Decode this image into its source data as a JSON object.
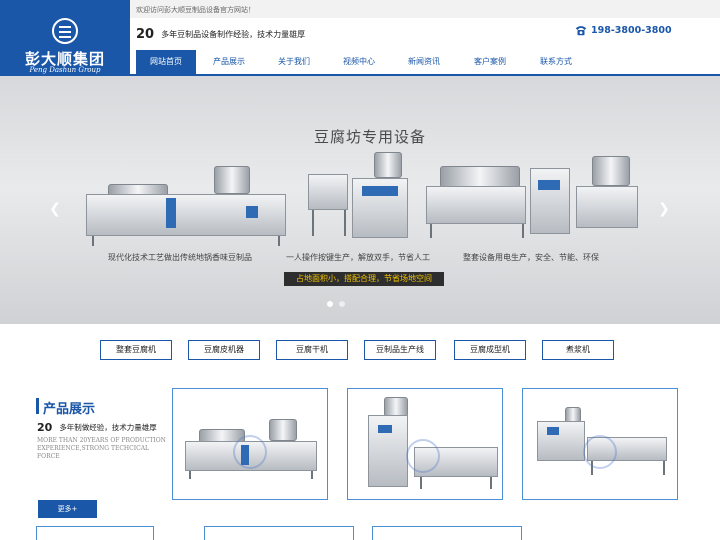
{
  "brand": {
    "name_cn": "彭大顺集团",
    "name_en": "Peng Dashun Group"
  },
  "topbar": {
    "welcome": "欢迎访问彭大顺豆制品设备官方网站！"
  },
  "slogan": {
    "number": "20",
    "text": "多年豆制品设备制作经验，技术力量雄厚"
  },
  "contact": {
    "phone": "198-3800-3800",
    "icon": "telephone-icon"
  },
  "nav": {
    "items": [
      {
        "label": "网站首页",
        "active": true
      },
      {
        "label": "产品展示",
        "active": false
      },
      {
        "label": "关于我们",
        "active": false
      },
      {
        "label": "视频中心",
        "active": false
      },
      {
        "label": "新闻资讯",
        "active": false
      },
      {
        "label": "客户案例",
        "active": false
      },
      {
        "label": "联系方式",
        "active": false
      }
    ]
  },
  "banner": {
    "title": "豆腐坊专用设备",
    "captions": [
      "现代化技术工艺做出传统地锅香味豆制品",
      "一人操作按键生产，解放双手，节省人工",
      "整套设备用电生产，安全、节能、环保"
    ],
    "highlight": "占地面积小，搭配合理，节省场地空间",
    "prev_icon": "chevron-left-icon",
    "next_icon": "chevron-right-icon",
    "slide_count": 2,
    "active_slide": 1
  },
  "categories": [
    "整套豆腐机",
    "豆腐皮机器",
    "豆腐干机",
    "豆制品生产线",
    "豆腐成型机",
    "煮浆机"
  ],
  "products": {
    "title": "产品展示",
    "number": "20",
    "subtitle": "多年制做经验，技术力量雄厚",
    "en_text": "MORE THAN 20YEARS OF PRODUCTION EXPERIENCE,STRONG TECHCICAL FORCE",
    "more_label": "更多+"
  },
  "colors": {
    "brand_blue": "#1a57a8",
    "card_border": "#4c8fd6",
    "highlight_text": "#f2c200"
  }
}
